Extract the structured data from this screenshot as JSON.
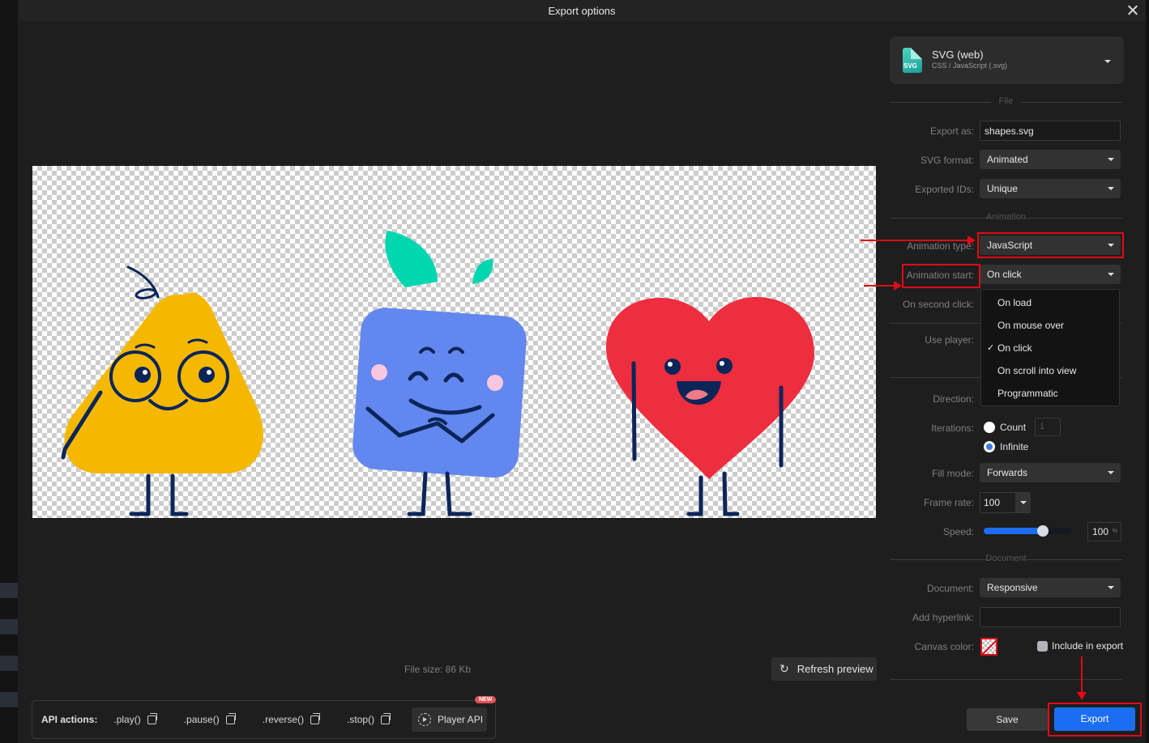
{
  "window": {
    "title": "Export options",
    "close_icon": "close-icon"
  },
  "preview": {
    "file_size": "File size: 86 Kb",
    "refresh_label": "Refresh preview",
    "refresh_icon": "refresh-icon",
    "characters": [
      "pear-character",
      "blue-square-character",
      "heart-character"
    ]
  },
  "api": {
    "label": "API actions:",
    "actions": [
      ".play()",
      ".pause()",
      ".reverse()",
      ".stop()"
    ],
    "player_api_label": "Player API",
    "new_badge": "NEW"
  },
  "format": {
    "icon_text": "SVG",
    "name": "SVG (web)",
    "subtitle": "CSS / JavaScript (.svg)"
  },
  "sections": {
    "file": "File",
    "animation": "Animation",
    "document": "Document"
  },
  "file": {
    "export_as_label": "Export as:",
    "export_as_value": "shapes.svg",
    "svg_format_label": "SVG format:",
    "svg_format_value": "Animated",
    "exported_ids_label": "Exported IDs:",
    "exported_ids_value": "Unique"
  },
  "animation": {
    "type_label": "Animation type:",
    "type_value": "JavaScript",
    "start_label": "Animation start:",
    "start_value": "On click",
    "second_click_label": "On second click:",
    "use_player_label": "Use player:",
    "direction_label": "Direction:",
    "start_options": [
      {
        "label": "On load",
        "selected": false
      },
      {
        "label": "On mouse over",
        "selected": false
      },
      {
        "label": "On click",
        "selected": true
      },
      {
        "label": "On scroll into view",
        "selected": false
      },
      {
        "label": "Programmatic",
        "selected": false
      }
    ],
    "check_glyph": "✓",
    "iterations_label": "Iterations:",
    "iterations_count_label": "Count",
    "iterations_count_value": "1",
    "iterations_infinite_label": "Infinite",
    "iterations_selected": "Infinite",
    "fill_mode_label": "Fill mode:",
    "fill_mode_value": "Forwards",
    "frame_rate_label": "Frame rate:",
    "frame_rate_value": "100",
    "speed_label": "Speed:",
    "speed_value": "100",
    "speed_unit": "%",
    "speed_slider_fraction": 0.68
  },
  "document": {
    "document_label": "Document:",
    "document_value": "Responsive",
    "hyperlink_label": "Add hyperlink:",
    "hyperlink_value": "",
    "canvas_color_label": "Canvas color:",
    "include_label": "Include in export",
    "include_checked": false
  },
  "footer": {
    "save_label": "Save",
    "export_label": "Export"
  },
  "colors": {
    "accent": "#1b6ef3",
    "annotation_red": "#e10b17",
    "radio_selected": "#3a7ce0"
  }
}
